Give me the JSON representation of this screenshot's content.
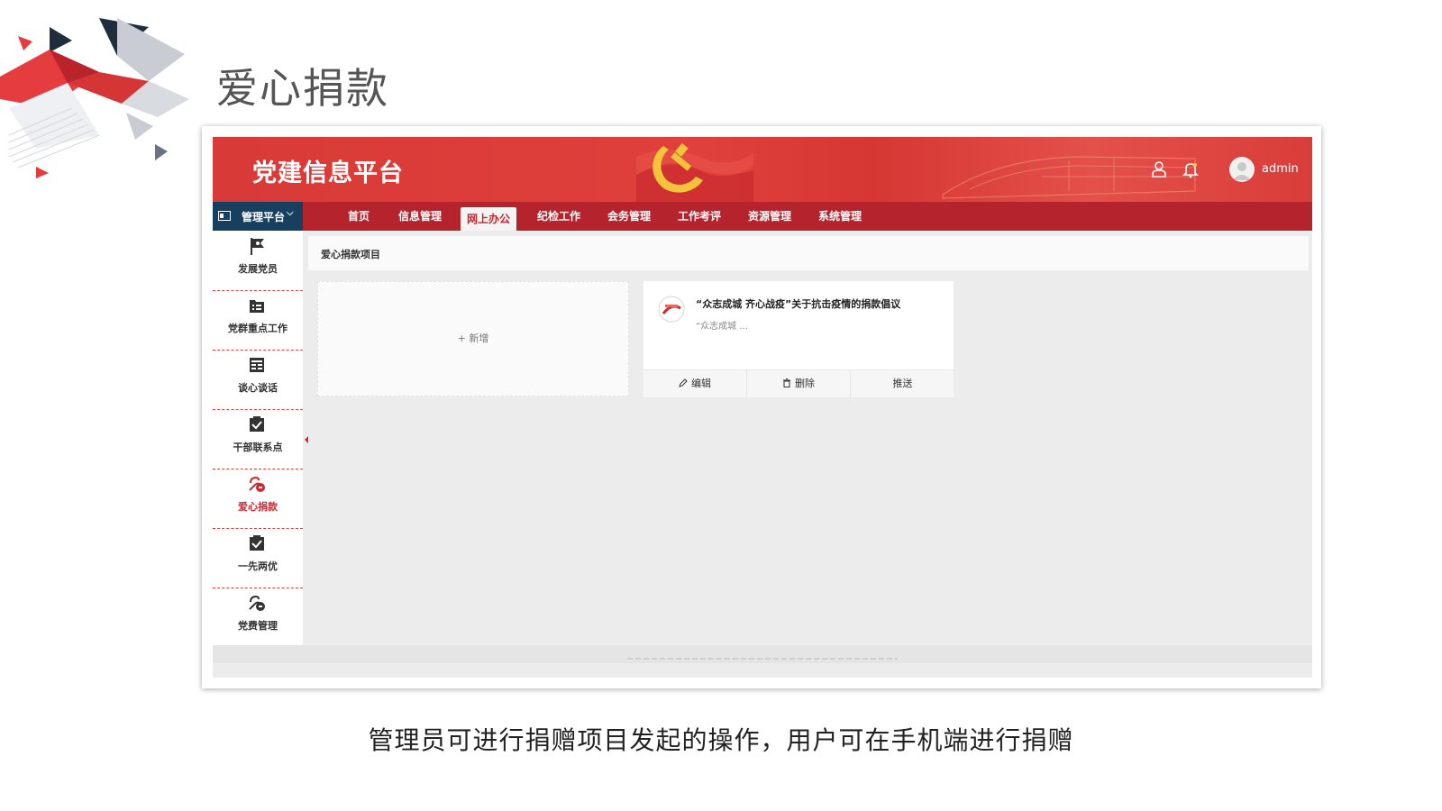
{
  "slide": {
    "title": "爱心捐款",
    "caption": "管理员可进行捐赠项目发起的操作，用户可在手机端进行捐赠"
  },
  "header": {
    "brand": "党建信息平台",
    "username": "admin",
    "icons": [
      "user-icon",
      "bell-icon",
      "avatar"
    ]
  },
  "navbar": {
    "platform_label": "管理平台",
    "items": [
      {
        "label": "首页",
        "active": false
      },
      {
        "label": "信息管理",
        "active": false
      },
      {
        "label": "网上办公",
        "active": true
      },
      {
        "label": "纪检工作",
        "active": false
      },
      {
        "label": "会务管理",
        "active": false
      },
      {
        "label": "工作考评",
        "active": false
      },
      {
        "label": "资源管理",
        "active": false
      },
      {
        "label": "系统管理",
        "active": false
      }
    ]
  },
  "sidebar": {
    "items": [
      {
        "label": "发展党员",
        "icon": "flag-icon",
        "active": false
      },
      {
        "label": "党群重点工作",
        "icon": "briefcase-list-icon",
        "active": false
      },
      {
        "label": "谈心谈话",
        "icon": "table-icon",
        "active": false
      },
      {
        "label": "干部联系点",
        "icon": "checkbox-icon",
        "active": false
      },
      {
        "label": "爱心捐款",
        "icon": "donation-icon",
        "active": true
      },
      {
        "label": "一先两优",
        "icon": "checkbox-icon",
        "active": false
      },
      {
        "label": "党费管理",
        "icon": "donation-icon",
        "active": false
      }
    ]
  },
  "content": {
    "breadcrumb": "爱心捐款项目",
    "add_card_label": "+ 新增",
    "project": {
      "title": "“众志成城 齐心战疫”关于抗击疫情的捐款倡议",
      "desc": "“众志成城 ...",
      "actions": {
        "edit": "编辑",
        "delete": "删除",
        "push": "推送"
      }
    }
  },
  "colors": {
    "header_red": "#d83a37",
    "nav_red": "#b5232c",
    "platform_navy": "#173f5f",
    "active_red": "#d0282e",
    "content_bg": "#ececec"
  }
}
